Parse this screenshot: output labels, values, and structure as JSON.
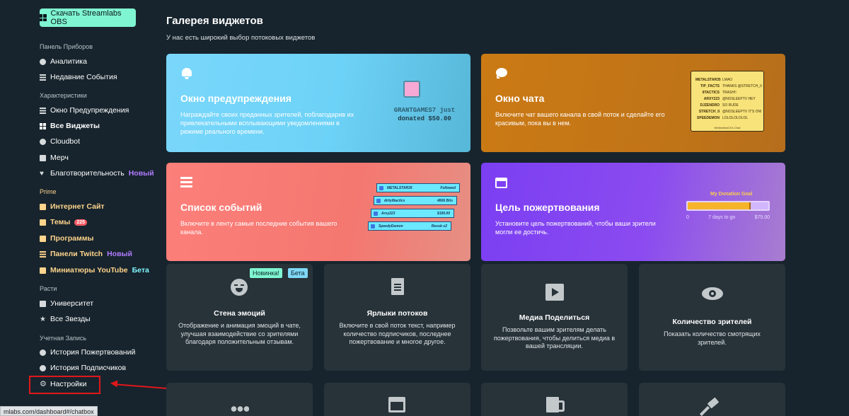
{
  "sidebar": {
    "download_label": "Скачать Streamlabs OBS",
    "sections": {
      "dashboard": "Панель Приборов",
      "features": "Характеристики",
      "prime": "Prime",
      "grow": "Расти",
      "account": "Учетная Запись"
    },
    "items": {
      "analytics": "Аналитика",
      "recent_events": "Недавние События",
      "alert_box": "Окно Предупреждения",
      "all_widgets": "Все Виджеты",
      "cloudbot": "Cloudbot",
      "merch": "Мерч",
      "charity": "Благотворительность",
      "website": "Интернет Сайт",
      "themes": "Темы",
      "apps": "Программы",
      "twitch_panels": "Панели Twitch",
      "yt_thumbnails": "Миниатюры YouTube",
      "university": "Университет",
      "all_stars": "Все Звезды",
      "donation_history": "История Пожертвований",
      "sub_history": "История Подписчиков",
      "settings": "Настройки"
    },
    "badges": {
      "new": "Новый",
      "themes_count": "225",
      "beta": "Бета"
    }
  },
  "status_url": "mlabs.com/dashboard#/chatbox",
  "main": {
    "title": "Галерея виджетов",
    "subtitle": "У нас есть широкий выбор потоковых виджетов"
  },
  "cards": {
    "alert": {
      "title": "Окно предупреждения",
      "desc": "Награждайте своих преданных зрителей, поблагодарив их привлекательными всплывающими уведомлениями в режиме реального времени.",
      "art_line1": "GRANTGAMES7 just",
      "art_line2": "donated $50.00"
    },
    "chat": {
      "title": "Окно чата",
      "desc": "Включите чат вашего канала в свой поток и сделайте его красивым, пока вы в нем.",
      "rows": [
        {
          "user": "METALSTAR35",
          "msg": "LMAO"
        },
        {
          "user": "TIP_FACTS",
          "msg": "THANKS @STRETCH_II"
        },
        {
          "user": "8TACTICS",
          "msg": "TRASH!!"
        },
        {
          "user": "ARXY223",
          "msg": "@NOSLEEPTV HEY"
        },
        {
          "user": "DJZENDRO",
          "msg": "SO RUDE"
        },
        {
          "user": "STRETCH_II",
          "msg": "@NOSLEEPTV IT'S ON!"
        },
        {
          "user": "SPEEDEMON",
          "msg": "LOLOLOLOLOL"
        }
      ],
      "footer": "WrittenMarCh's Chat"
    },
    "events": {
      "title": "Список событий",
      "desc": "Включите в ленту самые последние события вашего канала.",
      "rows": [
        {
          "name": "METALSTAR35",
          "info": "Followed"
        },
        {
          "name": "dirty8tactics",
          "info": "4806 Bits"
        },
        {
          "name": "Arxy223",
          "info": "$150.00"
        },
        {
          "name": "SpeedyDemon",
          "info": "Resub x2"
        }
      ]
    },
    "goal": {
      "title": "Цель пожертвования",
      "desc": "Установите цель пожертвований, чтобы ваши зрители могли ее достичь.",
      "art_title": "My Donation Goal",
      "start": "0",
      "middle": "7 days to go",
      "end": "$75.00",
      "progress": 0.78
    },
    "emote_wall": {
      "title": "Стена эмоций",
      "desc": "Отображение и анимация эмоций в чате, улучшая взаимодействие со зрителями благодаря положительным отзывам.",
      "tag_new": "Новинка!",
      "tag_beta": "Бета"
    },
    "stream_labels": {
      "title": "Ярлыки потоков",
      "desc": "Включите в свой поток текст, например количество подписчиков, последнее пожертвование и многое другое."
    },
    "media_share": {
      "title": "Медиа Поделиться",
      "desc": "Позвольте вашим зрителям делать пожертвования, чтобы делиться медиа в вашей трансляции."
    },
    "viewer_count": {
      "title": "Количество зрителей",
      "desc": "Показать количество смотрящих зрителей."
    }
  }
}
